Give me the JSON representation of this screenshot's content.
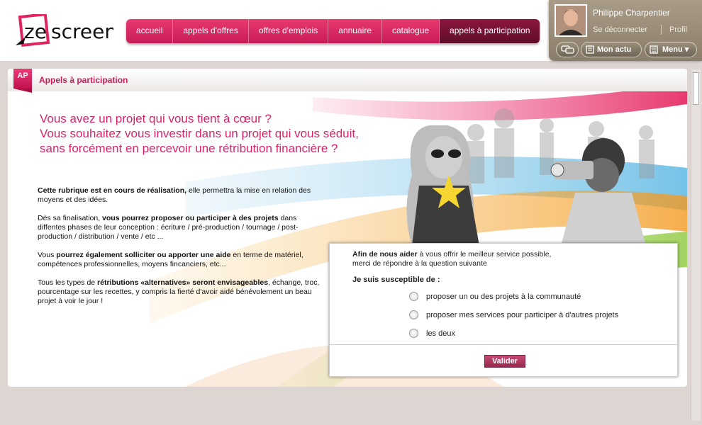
{
  "brand": {
    "logo_text": "zescreen"
  },
  "nav": {
    "items": [
      {
        "label": "accueil"
      },
      {
        "label": "appels d'offres"
      },
      {
        "label": "offres d'emplois"
      },
      {
        "label": "annuaire"
      },
      {
        "label": "catalogue"
      },
      {
        "label": "appels à participation"
      }
    ],
    "active_index": 5
  },
  "user": {
    "name": "Philippe Charpentier",
    "logout_label": "Se déconnecter",
    "profile_label": "Profil",
    "actu_label": "Mon actu",
    "menu_label": "Menu"
  },
  "panel": {
    "badge": "AP",
    "title": "Appels à participation"
  },
  "headline": {
    "line1": "Vous avez un projet qui vous tient à cœur ?",
    "line2": "Vous souhaitez vous investir dans un projet qui vous séduit,",
    "line3": "sans forcément en percevoir une rétribution financière ?"
  },
  "body": {
    "p1_bold": "Cette rubrique est en cours de réalisation,",
    "p1_rest": " elle permettra la mise en relation des moyens et des idées.",
    "p2_start": "Dès sa finalisation, ",
    "p2_bold": "vous pourrez proposer ou participer à des projets",
    "p2_rest": " dans diffentes phases de leur conception : écriture / pré-production / tournage / post-production / distribution / vente / etc ...",
    "p3_start": "Vous ",
    "p3_bold": "pourrez également solliciter ou apporter une aide",
    "p3_rest": " en terme de matériel, compétences professionnelles, moyens fincanciers, etc...",
    "p4_start": "Tous les types de ",
    "p4_bold": "rétributions «alternatives» seront envisageables",
    "p4_rest": ", échange, troc, pourcentage sur les recettes, y compris la fierté d'avoir aidé bénévolement un beau projet à voir le jour !"
  },
  "form": {
    "intro_bold": "Afin de nous aider",
    "intro_rest1": " à vous offrir le meilleur service possible,",
    "intro_rest2": "merci de répondre à la question suivante",
    "question": "Je suis susceptible de :",
    "options": [
      {
        "label": "proposer un ou des projets à la communauté"
      },
      {
        "label": "proposer mes services pour participer à d'autres projets"
      },
      {
        "label": "les deux"
      }
    ],
    "submit_label": "Valider"
  },
  "colors": {
    "accent": "#d6246b",
    "nav_red": "#d32a62",
    "nav_active": "#6e1030",
    "userbox": "#9a8e7a"
  }
}
